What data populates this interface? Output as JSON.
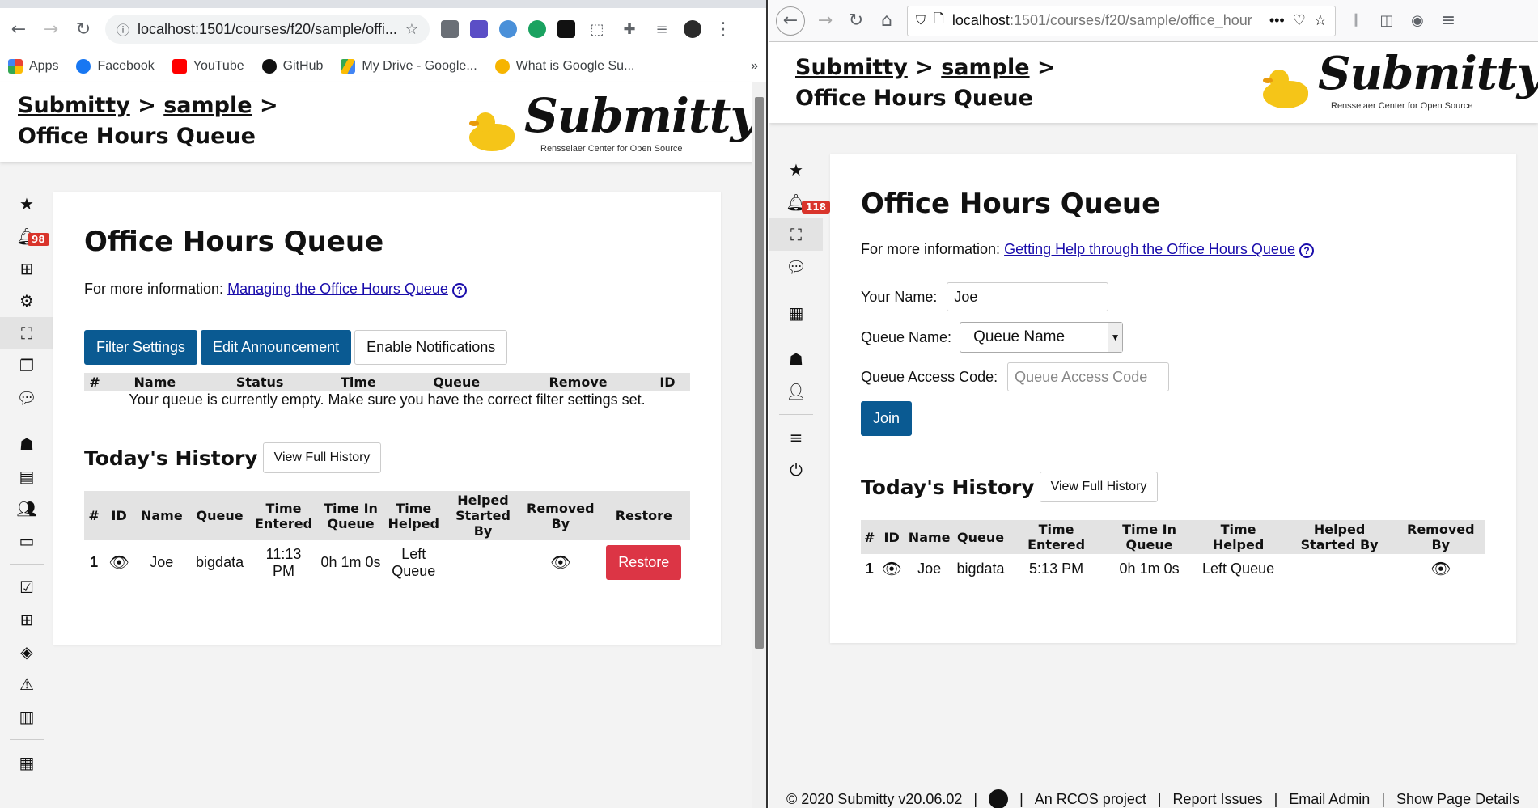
{
  "left": {
    "url": "localhost:1501/courses/f20/sample/offi...",
    "bookmarks": [
      "Apps",
      "Facebook",
      "YouTube",
      "GitHub",
      "My Drive - Google...",
      "What is Google Su..."
    ],
    "bookmarks_more": "»",
    "crumbs": {
      "course_root": "Submitty",
      "sep1": ">",
      "course": "sample",
      "sep2": ">",
      "page": "Office Hours Queue"
    },
    "logo": {
      "word": "Submitty",
      "tagline": "Rensselaer Center for Open Source"
    },
    "notification_count": "98",
    "title": "Office Hours Queue",
    "info_prefix": "For more information:",
    "info_link": "Managing the Office Hours Queue",
    "buttons": {
      "filter": "Filter Settings",
      "announcement": "Edit Announcement",
      "notifications": "Enable Notifications"
    },
    "queue_headers": [
      "#",
      "Name",
      "Status",
      "Time",
      "Queue",
      "Remove",
      "ID"
    ],
    "queue_empty": "Your queue is currently empty. Make sure you have the correct filter settings set.",
    "history_title": "Today's History",
    "history_button": "View Full History",
    "history_headers": [
      "#",
      "ID",
      "Name",
      "Queue",
      "Time Entered",
      "Time In Queue",
      "Time Helped",
      "Helped Started By",
      "Removed By",
      "Restore"
    ],
    "history_rows": [
      {
        "num": "1",
        "name": "Joe",
        "queue": "bigdata",
        "entered": "11:13 PM",
        "in_queue": "0h 1m 0s",
        "helped": "Left Queue",
        "restore": "Restore"
      }
    ]
  },
  "right": {
    "url_host": "localhost",
    "url_path": ":1501/courses/f20/sample/office_hour",
    "url_more": "•••",
    "crumbs": {
      "course_root": "Submitty",
      "sep1": ">",
      "course": "sample",
      "sep2": ">",
      "page": "Office Hours Queue"
    },
    "logo": {
      "word": "Submitty",
      "tagline": "Rensselaer Center for Open Source"
    },
    "notification_count": "118",
    "title": "Office Hours Queue",
    "info_prefix": "For more information:",
    "info_link": "Getting Help through the Office Hours Queue",
    "form": {
      "name_label": "Your Name:",
      "name_value": "Joe",
      "queue_label": "Queue Name:",
      "queue_selected": "Queue Name",
      "code_label": "Queue Access Code:",
      "code_placeholder": "Queue Access Code",
      "join": "Join"
    },
    "history_title": "Today's History",
    "history_button": "View Full History",
    "history_headers": [
      "#",
      "ID",
      "Name",
      "Queue",
      "Time Entered",
      "Time In Queue",
      "Time Helped",
      "Helped Started By",
      "Removed By"
    ],
    "history_rows": [
      {
        "num": "1",
        "name": "Joe",
        "queue": "bigdata",
        "entered": "5:13 PM",
        "in_queue": "0h 1m 0s",
        "helped": "Left Queue"
      }
    ],
    "footer": {
      "copyright": "© 2020 Submitty v20.06.02",
      "sep": "|",
      "rcos": "An RCOS project",
      "issues": "Report Issues",
      "email": "Email Admin",
      "details": "Show Page Details"
    }
  }
}
